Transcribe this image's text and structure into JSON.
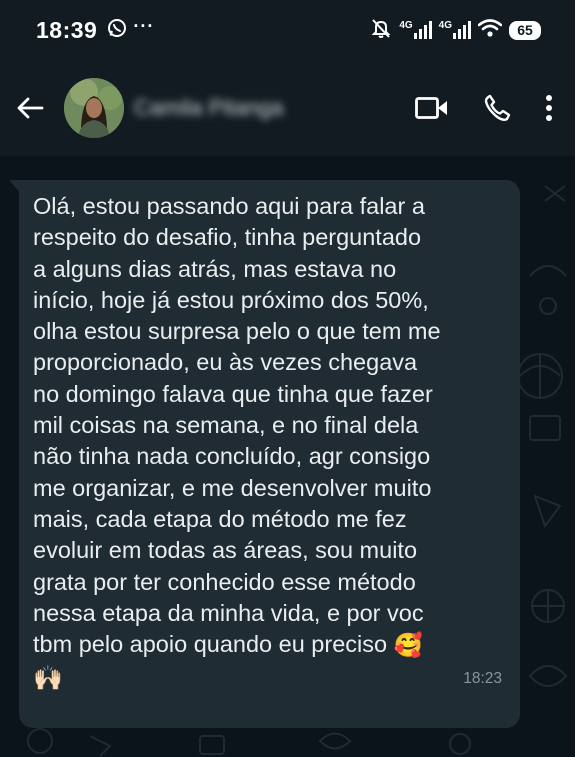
{
  "status_bar": {
    "time": "18:39",
    "whatsapp_icon": "whatsapp-icon",
    "dots": "···",
    "network1": "4G",
    "network2": "4G",
    "battery": "65"
  },
  "header": {
    "contact_name": "Camila Pitanga",
    "icons": [
      "back-arrow-icon",
      "video-call-icon",
      "phone-call-icon",
      "more-vert-icon"
    ]
  },
  "message": {
    "lines": [
      "Olá, estou passando aqui para falar a",
      "respeito do desafio, tinha perguntado",
      "a alguns dias atrás, mas estava no",
      "início, hoje já estou próximo dos 50%,",
      "olha estou surpresa pelo o que tem me",
      "proporcionado, eu às vezes chegava",
      "no domingo falava que tinha que fazer",
      "mil coisas na semana, e no final dela",
      "não tinha nada concluído, agr consigo",
      "me organizar, e me desenvolver muito",
      "mais, cada etapa do método me fez",
      "evoluir em todas as áreas, sou muito",
      "grata por ter conhecido esse método",
      "nessa etapa da minha vida, e por voc",
      "tbm pelo apoio quando eu preciso"
    ],
    "emoji_end": "🥰",
    "emoji_hands": "🙌🏻",
    "time": "18:23"
  },
  "colors": {
    "background": "#0b141a",
    "header": "#111b21",
    "bubble": "#1f2c34",
    "text": "#e9edef",
    "meta": "#8696a0"
  }
}
